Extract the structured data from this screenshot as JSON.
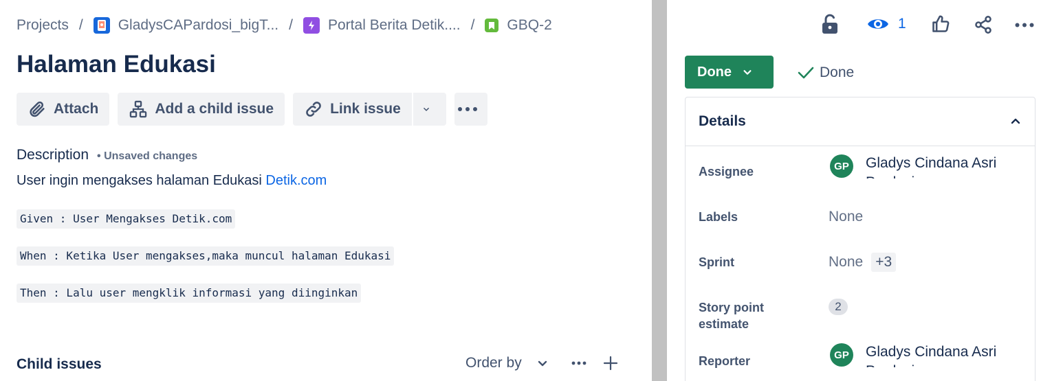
{
  "breadcrumb": {
    "projects": "Projects",
    "project": "GladysCAPardosi_bigT...",
    "epic": "Portal Berita Detik....",
    "issue_key": "GBQ-2"
  },
  "issue": {
    "title": "Halaman Edukasi"
  },
  "toolbar": {
    "attach": "Attach",
    "add_child": "Add a child issue",
    "link_issue": "Link issue"
  },
  "description": {
    "label": "Description",
    "unsaved": "• Unsaved changes",
    "text": "User ingin mengakses halaman Edukasi ",
    "link": "Detik.com",
    "code_lines": [
      "Given : User Mengakses Detik.com",
      "When : Ketika User mengakses,maka muncul halaman Edukasi",
      "Then : Lalu user mengklik informasi yang diinginkan"
    ]
  },
  "child_issues": {
    "label": "Child issues",
    "order_by": "Order by"
  },
  "header_actions": {
    "watch_count": "1"
  },
  "status": {
    "label": "Done",
    "resolution": "Done",
    "color": "#1f845a"
  },
  "details": {
    "title": "Details",
    "assignee": {
      "label": "Assignee",
      "initials": "GP",
      "name": "Gladys Cindana Asri Pardosi"
    },
    "labels": {
      "label": "Labels",
      "value": "None"
    },
    "sprint": {
      "label": "Sprint",
      "value": "None",
      "extra": "+3"
    },
    "story_points": {
      "label": "Story point estimate",
      "value": "2"
    },
    "reporter": {
      "label": "Reporter",
      "initials": "GP",
      "name": "Gladys Cindana Asri Pardosi"
    }
  },
  "icons": [
    "project-avatar-icon",
    "epic-lightning-icon",
    "story-bookmark-icon",
    "paperclip-icon",
    "hierarchy-icon",
    "link-icon",
    "chevron-down-icon",
    "more-icon",
    "unlock-icon",
    "eye-icon",
    "thumbs-up-icon",
    "share-icon",
    "checkmark-icon",
    "chevron-up-icon",
    "plus-icon"
  ]
}
